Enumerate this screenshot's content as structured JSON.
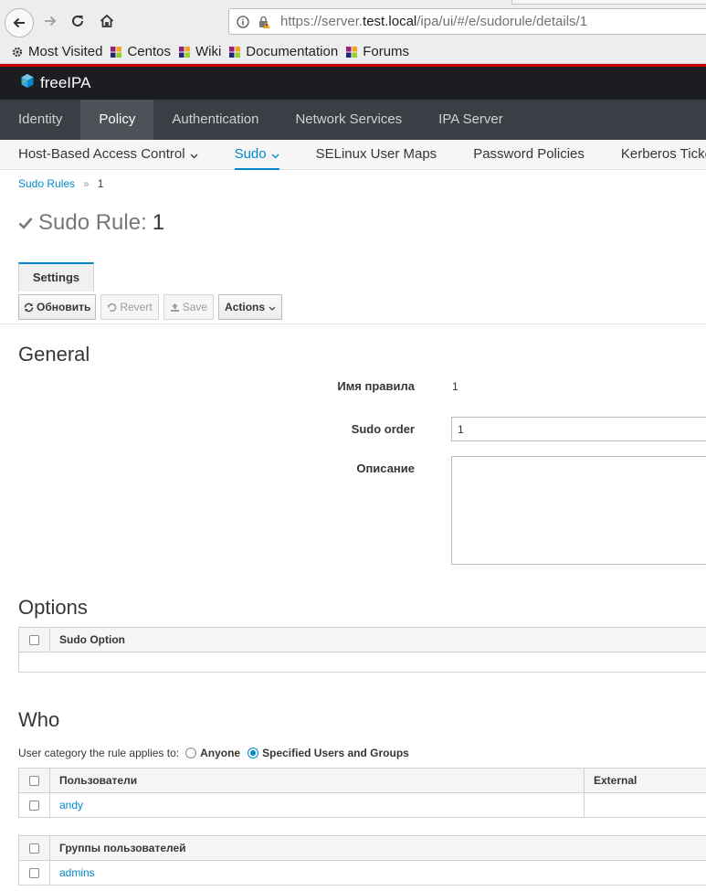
{
  "browser": {
    "url_prefix": "https://server.",
    "url_host": "test.local",
    "url_path": "/ipa/ui/#/e/sudorule/details/1",
    "bookmarks": [
      {
        "label": "Most Visited",
        "icon": "gear-icon"
      },
      {
        "label": "Centos",
        "icon": "centos-icon"
      },
      {
        "label": "Wiki",
        "icon": "centos-icon"
      },
      {
        "label": "Documentation",
        "icon": "centos-icon"
      },
      {
        "label": "Forums",
        "icon": "centos-icon"
      }
    ]
  },
  "app": {
    "brand": "freeIPA",
    "main_nav": [
      "Identity",
      "Policy",
      "Authentication",
      "Network Services",
      "IPA Server"
    ],
    "main_nav_active": "Policy",
    "sub_nav": [
      "Host-Based Access Control",
      "Sudo",
      "SELinux User Maps",
      "Password Policies",
      "Kerberos Ticket"
    ],
    "sub_nav_active": "Sudo",
    "accent_color": "#0088ce"
  },
  "breadcrumb": {
    "parent": "Sudo Rules",
    "separator": "»",
    "current": "1"
  },
  "page": {
    "title_type": "Sudo Rule:",
    "title_key": "1",
    "tab": "Settings",
    "buttons": {
      "refresh": "Обновить",
      "revert": "Revert",
      "save": "Save",
      "actions": "Actions"
    }
  },
  "general": {
    "heading": "General",
    "rule_name_label": "Имя правила",
    "rule_name_value": "1",
    "sudo_order_label": "Sudo order",
    "sudo_order_value": "1",
    "description_label": "Описание",
    "description_value": ""
  },
  "options": {
    "heading": "Options",
    "column": "Sudo Option"
  },
  "who": {
    "heading": "Who",
    "category_label": "User category the rule applies to:",
    "option_anyone": "Anyone",
    "option_specified": "Specified Users and Groups",
    "selected": "Specified Users and Groups",
    "users_table": {
      "columns": [
        "Пользователи",
        "External"
      ],
      "rows": [
        [
          "andy",
          ""
        ]
      ]
    },
    "groups_table": {
      "columns": [
        "Группы пользователей"
      ],
      "rows": [
        [
          "admins"
        ]
      ]
    }
  }
}
